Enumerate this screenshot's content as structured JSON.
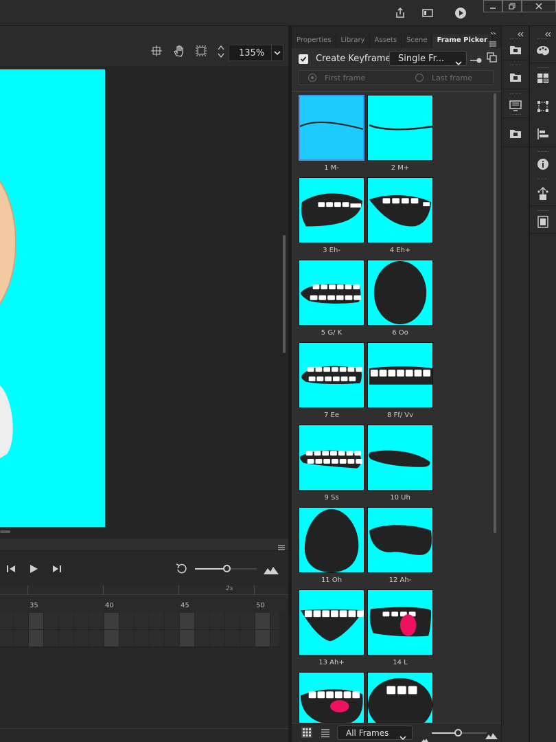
{
  "stage": {
    "zoom": "135%"
  },
  "timeline": {
    "ruler_time_label": "2s",
    "frame_numbers": [
      "35",
      "40",
      "45",
      "50"
    ]
  },
  "panel": {
    "tabs": [
      "Properties",
      "Library",
      "Assets",
      "Scene",
      "Frame Picker"
    ],
    "active_tab": "Frame Picker",
    "create_keyframe_label": "Create Keyframe",
    "create_keyframe_checked": true,
    "mode_select": "Single Fr...",
    "first_frame_label": "First frame",
    "last_frame_label": "Last frame",
    "frames": [
      {
        "label": "1 M-",
        "shape": "m-minus",
        "selected": true
      },
      {
        "label": "2 M+",
        "shape": "m-plus"
      },
      {
        "label": "3 Eh-",
        "shape": "eh-minus"
      },
      {
        "label": "4 Eh+",
        "shape": "eh-plus"
      },
      {
        "label": "5 G/ K",
        "shape": "gk"
      },
      {
        "label": "6 Oo",
        "shape": "oo"
      },
      {
        "label": "7 Ee",
        "shape": "ee"
      },
      {
        "label": "8 Ff/ Vv",
        "shape": "ffvv"
      },
      {
        "label": "9 Ss",
        "shape": "ss"
      },
      {
        "label": "10 Uh",
        "shape": "uh"
      },
      {
        "label": "11 Oh",
        "shape": "oh"
      },
      {
        "label": "12 Ah-",
        "shape": "ah-minus"
      },
      {
        "label": "13 Ah+",
        "shape": "ah-plus"
      },
      {
        "label": "14 L",
        "shape": "l"
      },
      {
        "label": "",
        "shape": "tongue"
      },
      {
        "label": "",
        "shape": "open"
      }
    ],
    "filter_select": "All Frames"
  },
  "colors": {
    "stage_bg": "#00ffff",
    "selected_thumb": "#1ecbff",
    "mouth": "#222222",
    "teeth": "#ffffff",
    "tongue": "#f01060"
  }
}
